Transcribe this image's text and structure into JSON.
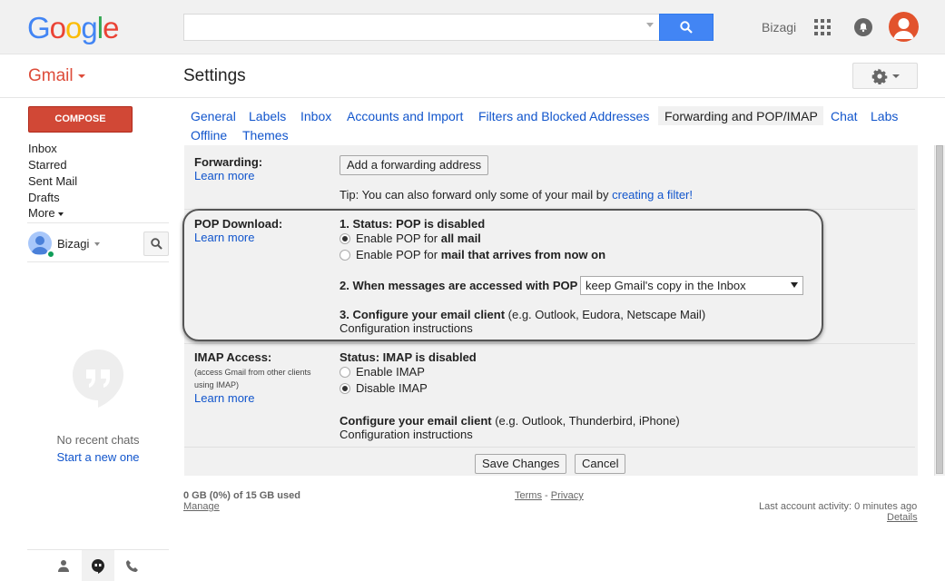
{
  "header": {
    "logo": {
      "letters": [
        "G",
        "o",
        "o",
        "g",
        "l",
        "e"
      ],
      "colors": [
        "#4285f4",
        "#ea4335",
        "#fbbc05",
        "#4285f4",
        "#34a853",
        "#ea4335"
      ]
    },
    "search": {
      "value": "",
      "placeholder": ""
    },
    "account_name": "Bizagi",
    "icons": [
      "search-icon",
      "apps-grid-icon",
      "notifications-icon",
      "avatar-icon"
    ]
  },
  "subheader": {
    "app_label": "Gmail",
    "page_title": "Settings",
    "gear_icon": "gear-icon"
  },
  "sidebar": {
    "compose_label": "COMPOSE",
    "nav": [
      "Inbox",
      "Starred",
      "Sent Mail",
      "Drafts",
      "More"
    ],
    "user_name": "Bizagi",
    "no_chats": "No recent chats",
    "start_new": "Start a new one",
    "bottom_tabs": [
      "person-icon",
      "hangouts-icon",
      "phone-icon"
    ]
  },
  "tabs": [
    {
      "label": "General",
      "active": false
    },
    {
      "label": "Labels",
      "active": false
    },
    {
      "label": "Inbox",
      "active": false
    },
    {
      "label": "Accounts and Import",
      "active": false
    },
    {
      "label": "Filters and Blocked Addresses",
      "active": false
    },
    {
      "label": "Forwarding and POP/IMAP",
      "active": true
    },
    {
      "label": "Chat",
      "active": false
    },
    {
      "label": "Labs",
      "active": false
    },
    {
      "label": "Offline",
      "active": false
    },
    {
      "label": "Themes",
      "active": false
    }
  ],
  "forwarding": {
    "title": "Forwarding:",
    "learn_more": "Learn more",
    "add_button": "Add a forwarding address",
    "tip_prefix": "Tip: You can also forward only some of your mail by ",
    "tip_link": "creating a filter!"
  },
  "pop": {
    "title": "POP Download:",
    "learn_more": "Learn more",
    "status": "1. Status: POP is disabled",
    "option1_prefix": "Enable POP for ",
    "option1_bold": "all mail",
    "option2_prefix": "Enable POP for ",
    "option2_bold": "mail that arrives from now on",
    "access_label": "2. When messages are accessed with POP",
    "access_value": "keep Gmail's copy in the Inbox",
    "configure_label": "3. Configure your email client",
    "configure_suffix": " (e.g. Outlook, Eudora, Netscape Mail)",
    "instructions": "Configuration instructions"
  },
  "imap": {
    "title": "IMAP Access:",
    "note": "(access Gmail from other clients using IMAP)",
    "learn_more": "Learn more",
    "status": "Status: IMAP is disabled",
    "enable": "Enable IMAP",
    "disable": "Disable IMAP",
    "configure_label": "Configure your email client",
    "configure_suffix": " (e.g. Outlook, Thunderbird, iPhone)",
    "instructions": "Configuration instructions"
  },
  "actions": {
    "save": "Save Changes",
    "cancel": "Cancel"
  },
  "footer": {
    "storage": "0 GB (0%) of 15 GB used",
    "manage": "Manage",
    "terms": "Terms",
    "separator": " - ",
    "privacy": "Privacy",
    "activity": "Last account activity: 0 minutes ago",
    "details": "Details"
  }
}
